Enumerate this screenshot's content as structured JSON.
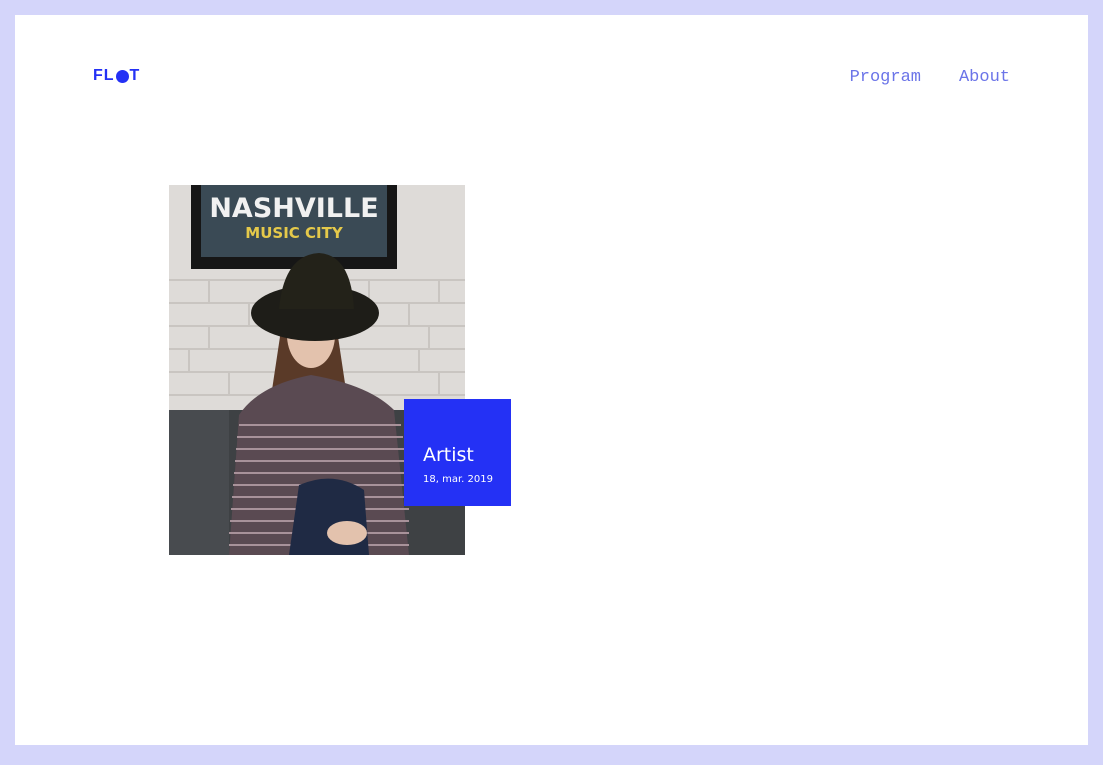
{
  "logo": {
    "part1": "FL",
    "part2": "T"
  },
  "nav": {
    "items": [
      {
        "label": "Program"
      },
      {
        "label": "About"
      }
    ]
  },
  "card": {
    "title": "Artist",
    "date": "18, mar. 2019",
    "sign_line1": "NASHVILLE",
    "sign_line2": "MUSIC CITY"
  },
  "colors": {
    "page_border": "#d4d5fa",
    "accent": "#2431f5",
    "nav_text": "#6b74e8"
  },
  "icons": {
    "logo_dot": "filled-circle"
  }
}
